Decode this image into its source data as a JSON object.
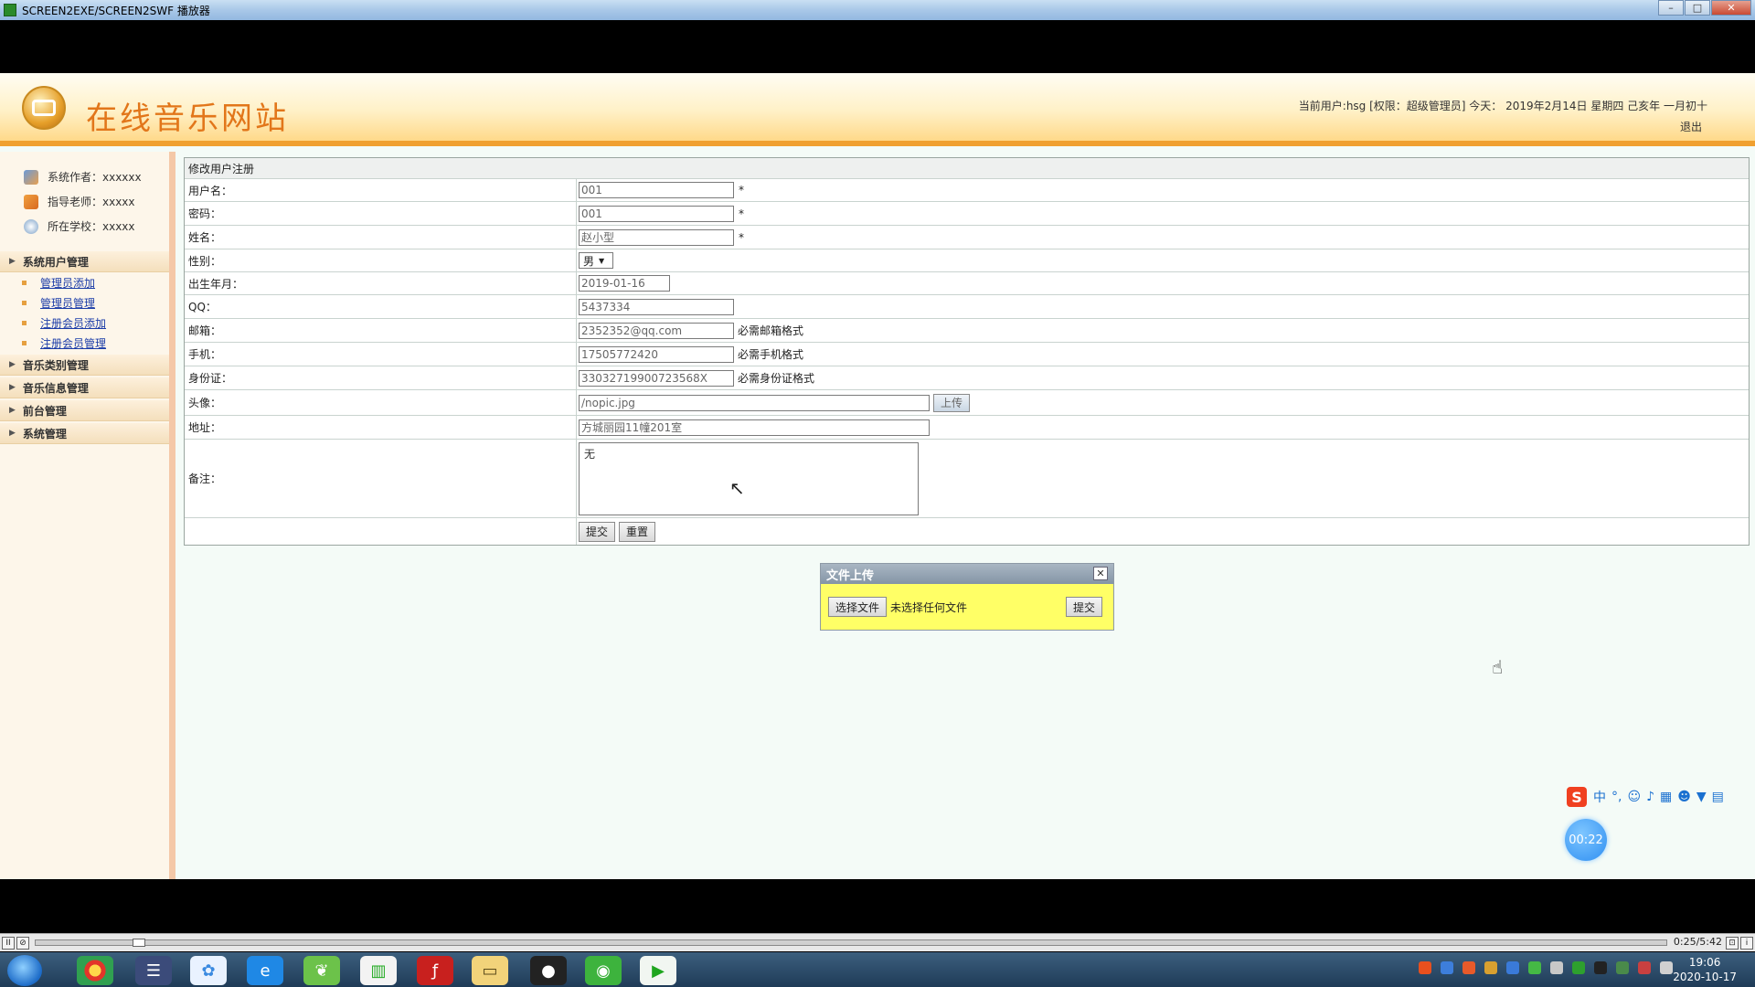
{
  "window": {
    "title": "SCREEN2EXE/SCREEN2SWF 播放器"
  },
  "header": {
    "site_title": "在线音乐网站",
    "user_info": "当前用户:hsg [权限：超级管理员] 今天： 2019年2月14日 星期四 己亥年 一月初十",
    "logout": "退出"
  },
  "sidebar": {
    "info": [
      {
        "label": "系统作者：xxxxxx",
        "icon": "people-icon"
      },
      {
        "label": "指导老师：xxxxx",
        "icon": "teacher-icon"
      },
      {
        "label": "所在学校：xxxxx",
        "icon": "school-icon"
      }
    ],
    "menus": [
      {
        "label": "系统用户管理",
        "items": [
          "管理员添加",
          "管理员管理",
          "注册会员添加",
          "注册会员管理"
        ]
      },
      {
        "label": "音乐类别管理",
        "items": []
      },
      {
        "label": "音乐信息管理",
        "items": []
      },
      {
        "label": "前台管理",
        "items": []
      },
      {
        "label": "系统管理",
        "items": []
      }
    ]
  },
  "form": {
    "caption": "修改用户注册",
    "username": {
      "label": "用户名：",
      "value": "001",
      "required": "*"
    },
    "password": {
      "label": "密码：",
      "value": "001",
      "required": "*"
    },
    "name": {
      "label": "姓名：",
      "value": "赵小型",
      "required": "*"
    },
    "gender": {
      "label": "性别：",
      "value": "男"
    },
    "birthday": {
      "label": "出生年月：",
      "value": "2019-01-16"
    },
    "qq": {
      "label": "QQ：",
      "value": "5437334"
    },
    "email": {
      "label": "邮箱：",
      "value": "2352352@qq.com",
      "hint": "必需邮箱格式"
    },
    "phone": {
      "label": "手机：",
      "value": "17505772420",
      "hint": "必需手机格式"
    },
    "idcard": {
      "label": "身份证：",
      "value": "330327199007235​68X",
      "hint": "必需身份证格式"
    },
    "avatar": {
      "label": "头像：",
      "value": "/nopic.jpg",
      "upload_label": "上传"
    },
    "address": {
      "label": "地址：",
      "value": "方城丽园11幢201室"
    },
    "remark": {
      "label": "备注：",
      "value": "无"
    },
    "submit_label": "提交",
    "reset_label": "重置"
  },
  "upload_dialog": {
    "title": "文件上传",
    "close": "✕",
    "choose_label": "选择文件",
    "no_file": "未选择任何文件",
    "submit_label": "提交"
  },
  "overlay": {
    "timer": "00:22",
    "ime_logo": "S",
    "ime_mode": "中"
  },
  "player": {
    "timecode": "0:25/5:42",
    "progress": 0.06
  },
  "taskbar": {
    "time": "19:06",
    "date": "2020-10-17"
  }
}
